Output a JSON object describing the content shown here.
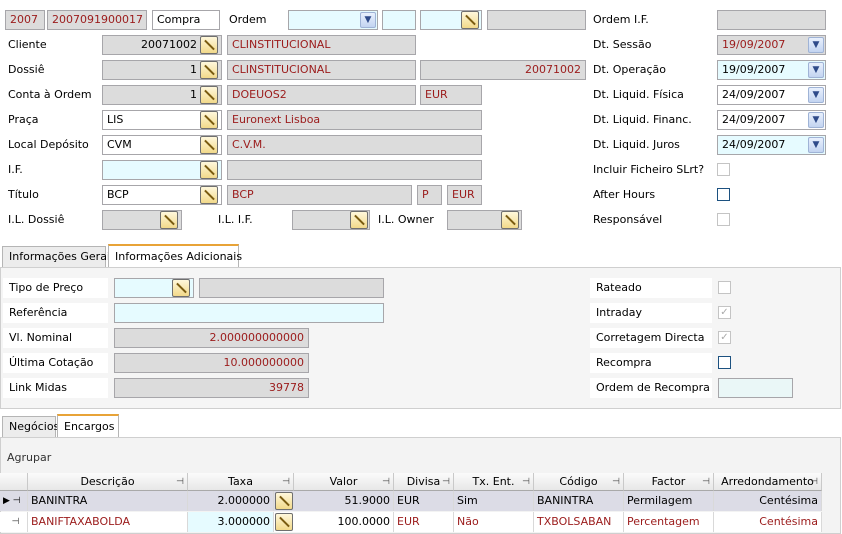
{
  "header": {
    "doc_type_code": "2007",
    "doc_number": "2007091900017",
    "operation": "Compra",
    "ordem_label": "Ordem",
    "ordem_if_label": "Ordem I.F."
  },
  "form": {
    "cliente": {
      "label": "Cliente",
      "code": "20071002",
      "name": "CLINSTITUCIONAL"
    },
    "dossie": {
      "label": "Dossiê",
      "code": "1",
      "name": "CLINSTITUCIONAL",
      "extra": "20071002"
    },
    "conta_ordem": {
      "label": "Conta à Ordem",
      "code": "1",
      "name": "DOEUOS2",
      "currency": "EUR"
    },
    "praca": {
      "label": "Praça",
      "code": "LIS",
      "name": "Euronext Lisboa"
    },
    "local_deposito": {
      "label": "Local Depósito",
      "code": "CVM",
      "name": "C.V.M."
    },
    "if": {
      "label": "I.F.",
      "code": "",
      "name": ""
    },
    "titulo": {
      "label": "Título",
      "code": "BCP",
      "name": "BCP",
      "type": "P",
      "currency": "EUR"
    },
    "il_dossie": {
      "label": "I.L. Dossiê"
    },
    "il_if": {
      "label": "I.L. I.F."
    },
    "il_owner": {
      "label": "I.L. Owner"
    }
  },
  "dates": {
    "dt_sessao": {
      "label": "Dt. Sessão",
      "value": "19/09/2007"
    },
    "dt_operacao": {
      "label": "Dt. Operação",
      "value": "19/09/2007"
    },
    "dt_liq_fisica": {
      "label": "Dt. Liquid. Física",
      "value": "24/09/2007"
    },
    "dt_liq_financ": {
      "label": "Dt. Liquid. Financ.",
      "value": "24/09/2007"
    },
    "dt_liq_juros": {
      "label": "Dt. Liquid. Juros",
      "value": "24/09/2007"
    }
  },
  "flags": {
    "incluir_ficheiro": {
      "label": "Incluir Ficheiro SLrt?",
      "checked": false
    },
    "after_hours": {
      "label": "After Hours",
      "checked": false
    },
    "responsavel": {
      "label": "Responsável",
      "checked": false
    }
  },
  "tabs1": [
    {
      "label": "Informações Gerais",
      "selected": false
    },
    {
      "label": "Informações Adicionais",
      "selected": true
    }
  ],
  "adicionais": {
    "tipo_preco": {
      "label": "Tipo de Preço",
      "value": ""
    },
    "referencia": {
      "label": "Referência",
      "value": ""
    },
    "vl_nominal": {
      "label": "Vl. Nominal",
      "value": "2.000000000000"
    },
    "ultima_cotacao": {
      "label": "Última Cotação",
      "value": "10.000000000"
    },
    "link_midas": {
      "label": "Link Midas",
      "value": "39778"
    },
    "rateado": {
      "label": "Rateado",
      "checked": false
    },
    "intraday": {
      "label": "Intraday",
      "checked": true
    },
    "corretagem_directa": {
      "label": "Corretagem Directa",
      "checked": true
    },
    "recompra": {
      "label": "Recompra",
      "checked": false
    },
    "ordem_recompra": {
      "label": "Ordem de Recompra",
      "value": ""
    }
  },
  "tabs2": [
    {
      "label": "Negócios",
      "selected": false
    },
    {
      "label": "Encargos",
      "selected": true
    }
  ],
  "grid": {
    "group_label": "Agrupar",
    "columns": [
      "Descrição",
      "Taxa",
      "Valor",
      "Divisa",
      "Tx. Ent.",
      "Código",
      "Factor",
      "Arredondamento"
    ],
    "rows": [
      {
        "descricao": "BANINTRA",
        "taxa": "2.000000",
        "valor": "51.9000",
        "divisa": "EUR",
        "tx_ent": "Sim",
        "codigo": "BANINTRA",
        "factor": "Permilagem",
        "arredondamento": "Centésima"
      },
      {
        "descricao": "BANIFTAXABOLDA",
        "taxa": "3.000000",
        "valor": "100.0000",
        "divisa": "EUR",
        "tx_ent": "Não",
        "codigo": "TXBOLSABAN",
        "factor": "Percentagem",
        "arredondamento": "Centésima"
      }
    ]
  },
  "colors": {
    "accent_tab": "#e8a337",
    "red_text": "#9b1b1b",
    "selected_row": "#dcdce6"
  }
}
